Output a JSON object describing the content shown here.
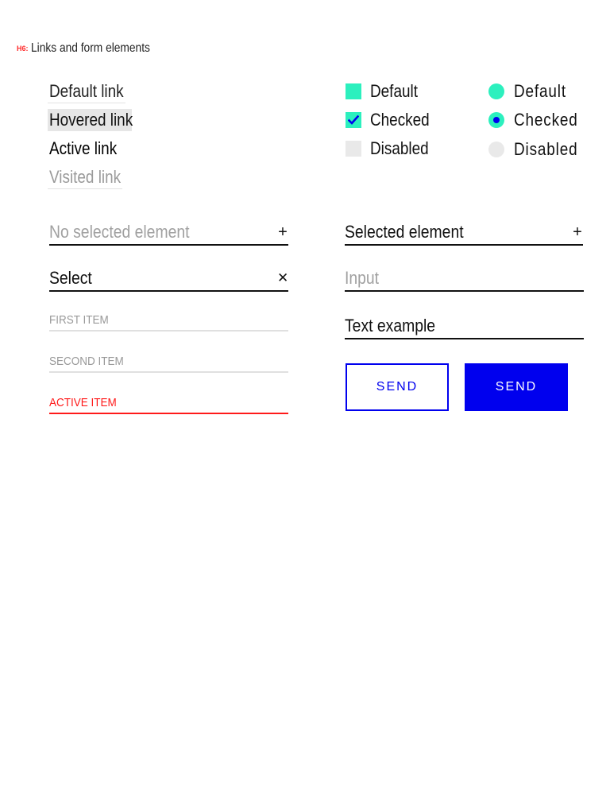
{
  "header": {
    "tag": "H6:",
    "title": "Links and form elements"
  },
  "links": {
    "default": "Default link",
    "hovered": "Hovered link",
    "active": "Active link",
    "visited": "Visited link"
  },
  "checkboxes": {
    "default": "Default",
    "checked": "Checked",
    "disabled": "Disabled"
  },
  "radios": {
    "default": "Default",
    "checked": "Checked",
    "disabled": "Disabled"
  },
  "selects": {
    "empty_placeholder": "No selected element",
    "selected_value": "Selected element",
    "open_label": "Select"
  },
  "dropdown": {
    "items": [
      "FIRST ITEM",
      "SECOND ITEM",
      "ACTIVE ITEM"
    ]
  },
  "inputs": {
    "empty_placeholder": "Input",
    "filled_value": "Text example"
  },
  "buttons": {
    "outline_label": "SEND",
    "solid_label": "SEND"
  },
  "icons": {
    "plus": "plus-icon",
    "close": "close-icon",
    "check": "checkmark-icon"
  },
  "colors": {
    "accent_blue": "#0000ee",
    "mint": "#2cf0be",
    "active_red": "#ff1a1a",
    "disabled_gray": "#e9e9e9"
  }
}
